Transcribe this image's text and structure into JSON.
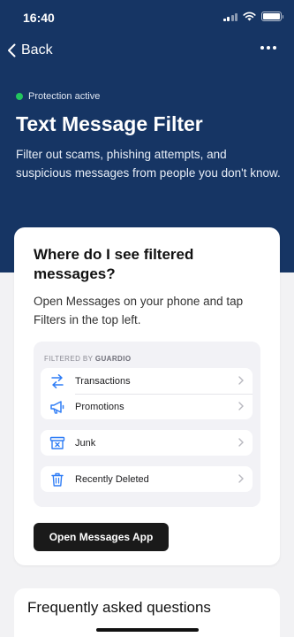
{
  "status_bar": {
    "time": "16:40"
  },
  "nav": {
    "back_label": "Back"
  },
  "hero": {
    "status": "Protection active",
    "title": "Text Message Filter",
    "subtitle": "Filter out scams, phishing attempts, and suspicious messages from people you don't know."
  },
  "card": {
    "title": "Where do I see filtered messages?",
    "text": "Open Messages on your phone and tap Filters in the top left.",
    "preview": {
      "label_prefix": "FILTERED BY",
      "label_brand": "GUARDIO",
      "items": [
        {
          "label": "Transactions",
          "icon": "arrows-swap-icon"
        },
        {
          "label": "Promotions",
          "icon": "megaphone-icon"
        },
        {
          "label": "Junk",
          "icon": "junk-bin-icon"
        },
        {
          "label": "Recently Deleted",
          "icon": "trash-icon"
        }
      ]
    },
    "button_label": "Open Messages App"
  },
  "faq": {
    "title": "Frequently asked questions"
  },
  "colors": {
    "hero_bg": "#163564",
    "accent_blue": "#2f7df6",
    "status_green": "#22c55e",
    "button_bg": "#1a1a1a"
  }
}
